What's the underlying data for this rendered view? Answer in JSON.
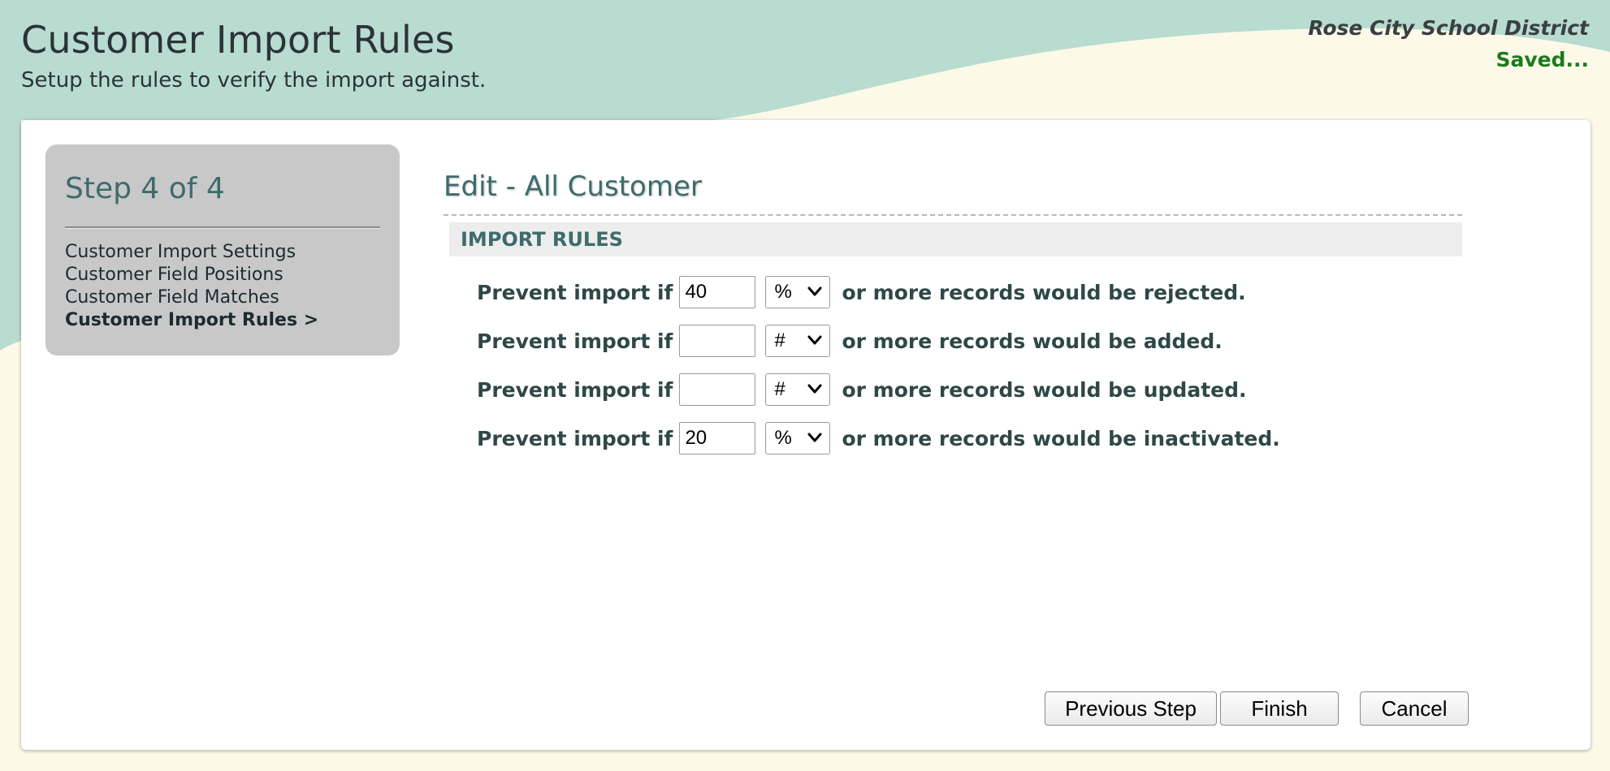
{
  "header": {
    "title": "Customer Import Rules",
    "subtitle": "Setup the rules to verify the import against.",
    "district": "Rose City School District",
    "status": "Saved..."
  },
  "steps": {
    "title": "Step 4 of 4",
    "items": [
      {
        "label": "Customer Import Settings",
        "current": false
      },
      {
        "label": "Customer Field Positions",
        "current": false
      },
      {
        "label": "Customer Field Matches",
        "current": false
      },
      {
        "label": "Customer Import Rules >",
        "current": true
      }
    ]
  },
  "main": {
    "title": "Edit - All Customer",
    "section_title": "IMPORT RULES",
    "rules": [
      {
        "prefix": "Prevent import if",
        "value": "40",
        "unit": "%",
        "suffix": "or more records would be rejected."
      },
      {
        "prefix": "Prevent import if",
        "value": "",
        "unit": "#",
        "suffix": "or more records would be added."
      },
      {
        "prefix": "Prevent import if",
        "value": "",
        "unit": "#",
        "suffix": "or more records would be updated."
      },
      {
        "prefix": "Prevent import if",
        "value": "20",
        "unit": "%",
        "suffix": "or more records would be inactivated."
      }
    ]
  },
  "buttons": {
    "previous": "Previous Step",
    "finish": "Finish",
    "cancel": "Cancel"
  },
  "colors": {
    "background_cream": "#fcf9e8",
    "wave_green": "#b8dccf",
    "heading_teal": "#3e6b6b",
    "status_green": "#1c7a1c"
  }
}
